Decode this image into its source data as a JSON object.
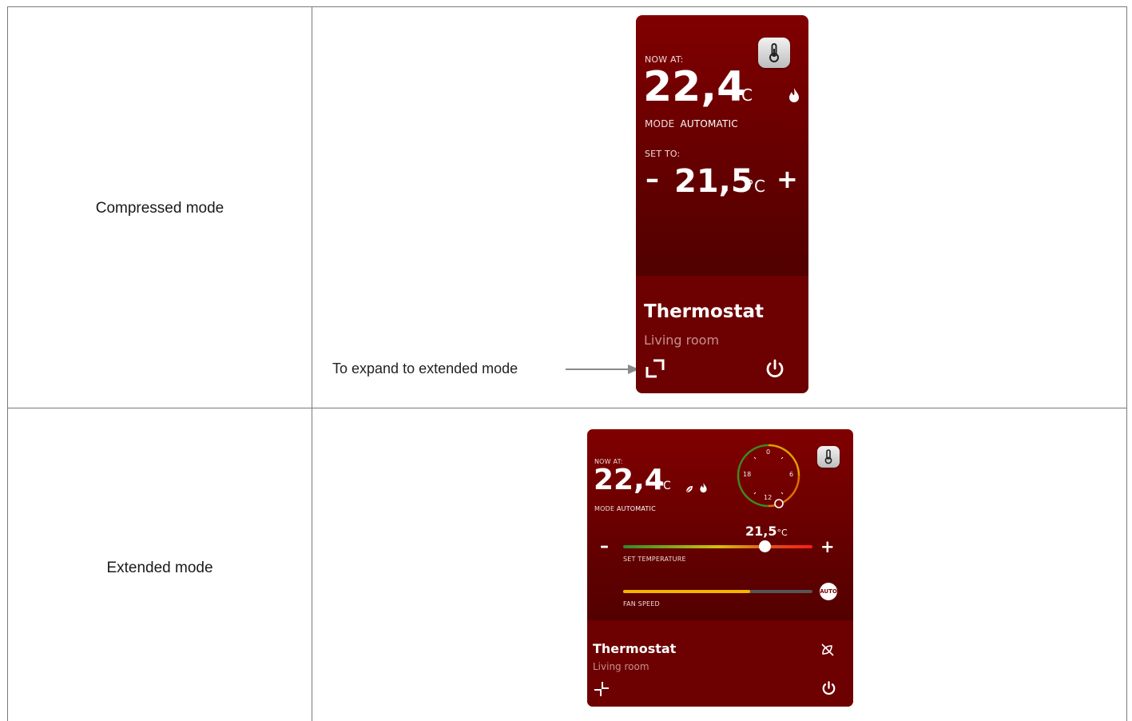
{
  "rows": {
    "compressed_label": "Compressed mode",
    "extended_label": "Extended mode",
    "expand_annotation": "To expand to extended mode"
  },
  "compressed": {
    "now_at_label": "NOW AT:",
    "current_temp": "22,4",
    "unit": "°C",
    "mode_label": "MODE",
    "mode_value": "AUTOMATIC",
    "set_to_label": "SET TO:",
    "minus": "–",
    "set_temp": "21,5",
    "plus": "+",
    "title": "Thermostat",
    "subtitle": "Living room",
    "icons": [
      "thermometer-icon",
      "flame-icon",
      "expand-icon",
      "power-icon"
    ]
  },
  "extended": {
    "now_at_label": "NOW AT:",
    "current_temp": "22,4",
    "unit": "°C",
    "mode_label": "MODE",
    "mode_value": "AUTOMATIC",
    "clock_labels": [
      "0",
      "6",
      "12",
      "18"
    ],
    "set_temp": "21,5",
    "set_temp_label": "SET TEMPERATURE",
    "minus": "–",
    "plus": "+",
    "fan_speed_label": "FAN SPEED",
    "fan_auto": "AUTO",
    "set_temp_fraction": 0.75,
    "fan_speed_fraction": 0.67,
    "title": "Thermostat",
    "subtitle": "Living room",
    "icons": [
      "thermometer-icon",
      "leaf-icon",
      "flame-icon",
      "schedule-off-icon",
      "collapse-icon",
      "power-icon"
    ]
  },
  "colors": {
    "card_red": "#800000",
    "bottom_red": "#6d0000",
    "annotation_arrow": "#8a8a8a"
  }
}
